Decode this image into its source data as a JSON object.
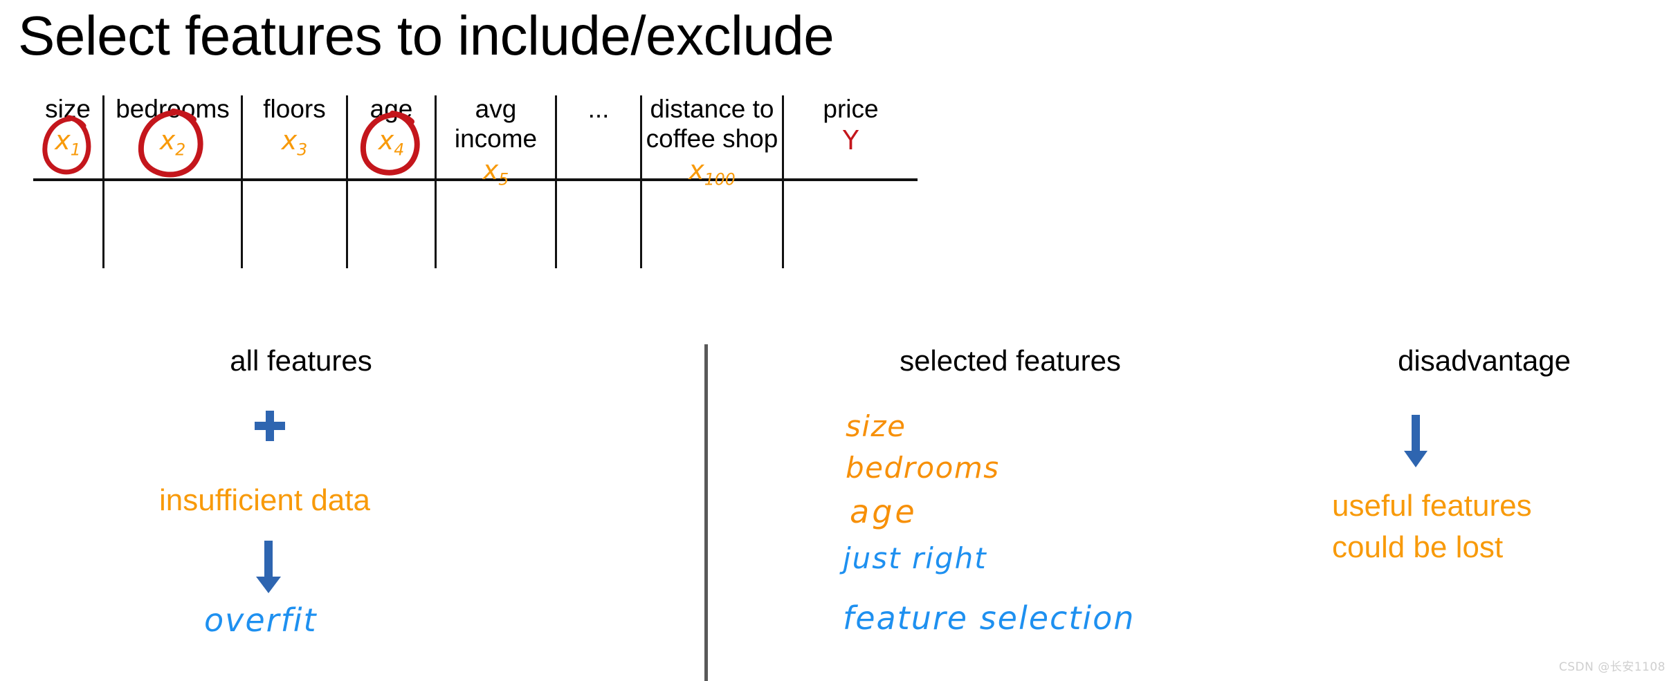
{
  "slide": {
    "title": "Select features to include/exclude",
    "background_color": "#ffffff"
  },
  "colors": {
    "orange": "#F89A0A",
    "blue": "#2E65B0",
    "hand_blue": "#1E90F0",
    "red": "#C4161C",
    "black": "#000000",
    "divider_gray": "#595959"
  },
  "feature_table": {
    "columns": [
      {
        "name": "size",
        "variable": "x",
        "subscript": "1",
        "circled": true,
        "is_target": false
      },
      {
        "name": "bedrooms",
        "variable": "x",
        "subscript": "2",
        "circled": true,
        "is_target": false
      },
      {
        "name": "floors",
        "variable": "x",
        "subscript": "3",
        "circled": false,
        "is_target": false
      },
      {
        "name": "age",
        "variable": "x",
        "subscript": "4",
        "circled": true,
        "is_target": false
      },
      {
        "name": "avg income",
        "variable": "x",
        "subscript": "5",
        "circled": false,
        "is_target": false
      },
      {
        "name": "...",
        "variable": "",
        "subscript": "",
        "circled": false,
        "is_target": false
      },
      {
        "name": "distance to coffee shop",
        "variable": "x",
        "subscript": "100",
        "circled": false,
        "is_target": false
      },
      {
        "name": "price",
        "variable": "Y",
        "subscript": "",
        "circled": false,
        "is_target": true
      }
    ]
  },
  "panels": {
    "all_features": {
      "heading": "all features",
      "plus_symbol": "+",
      "consequence": "insufficient data",
      "arrow_symbol": "↓",
      "result": "overfit"
    },
    "selected_features": {
      "heading": "selected features",
      "list": [
        "size",
        "bedrooms",
        "age"
      ],
      "verdict": "just right",
      "technique": "feature selection"
    },
    "disadvantage": {
      "heading": "disadvantage",
      "arrow_symbol": "↓",
      "line1": "useful features",
      "line2": "could be lost"
    }
  },
  "watermark": {
    "text": "CSDN @长安1108"
  }
}
